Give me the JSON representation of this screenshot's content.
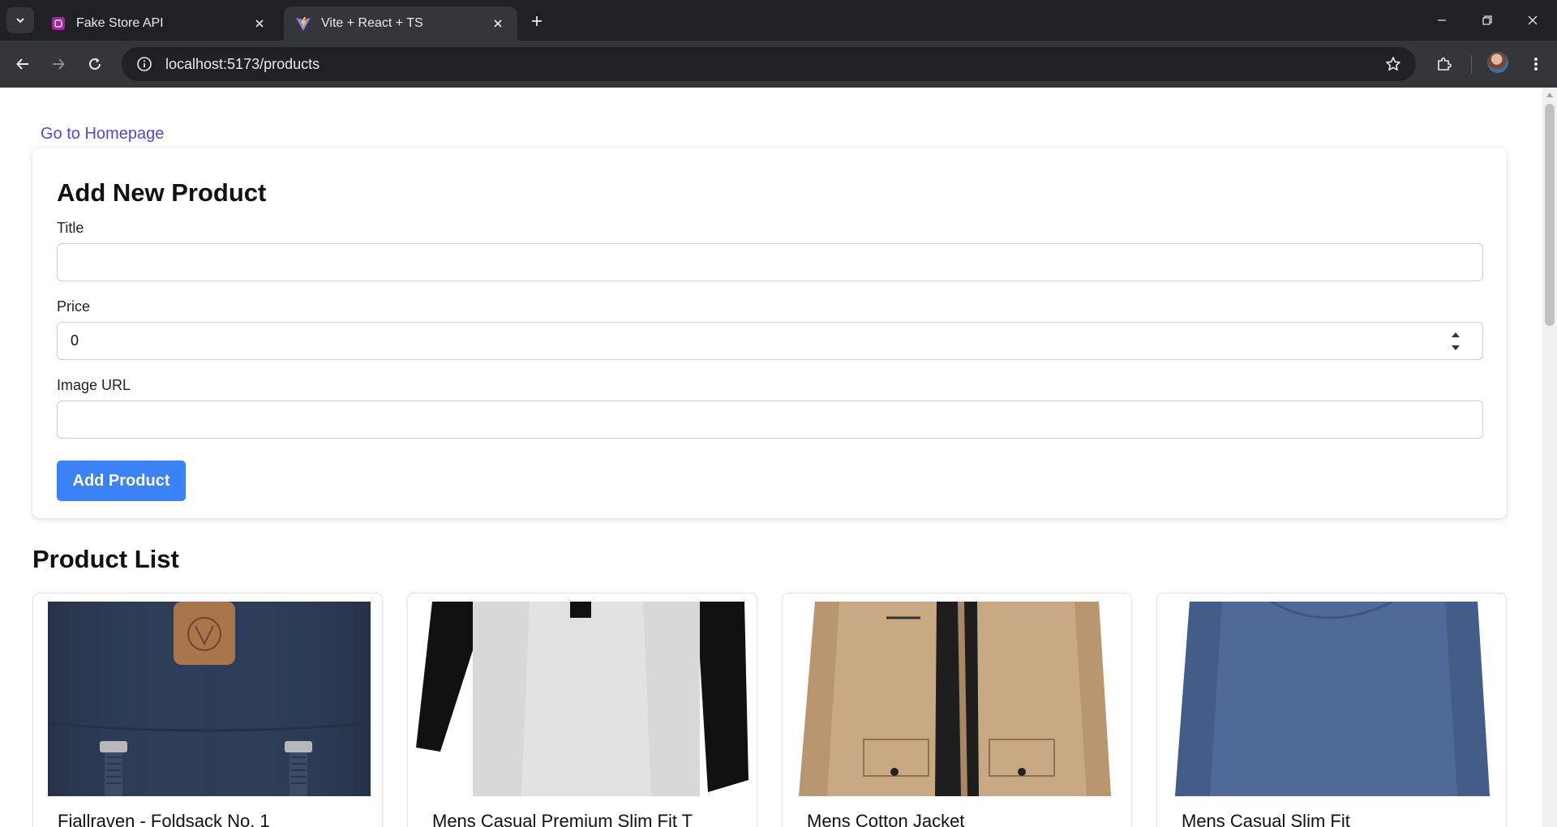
{
  "browser": {
    "tabs": [
      {
        "title": "Fake Store API",
        "active": false
      },
      {
        "title": "Vite + React + TS",
        "active": true
      }
    ],
    "url": "localhost:5173/products"
  },
  "page": {
    "home_link": "Go to Homepage",
    "form": {
      "heading": "Add New Product",
      "title_label": "Title",
      "title_value": "",
      "price_label": "Price",
      "price_value": "0",
      "image_label": "Image URL",
      "image_value": "",
      "submit_label": "Add Product"
    },
    "list_heading": "Product List",
    "products": [
      {
        "title": "Fjallraven - Foldsack No. 1"
      },
      {
        "title": "Mens Casual Premium Slim Fit T"
      },
      {
        "title": "Mens Cotton Jacket"
      },
      {
        "title": "Mens Casual Slim Fit"
      }
    ]
  },
  "colors": {
    "link": "#4f46e5",
    "button": "#3b82f6",
    "chrome_dark": "#202124",
    "chrome_toolbar": "#35363a"
  }
}
